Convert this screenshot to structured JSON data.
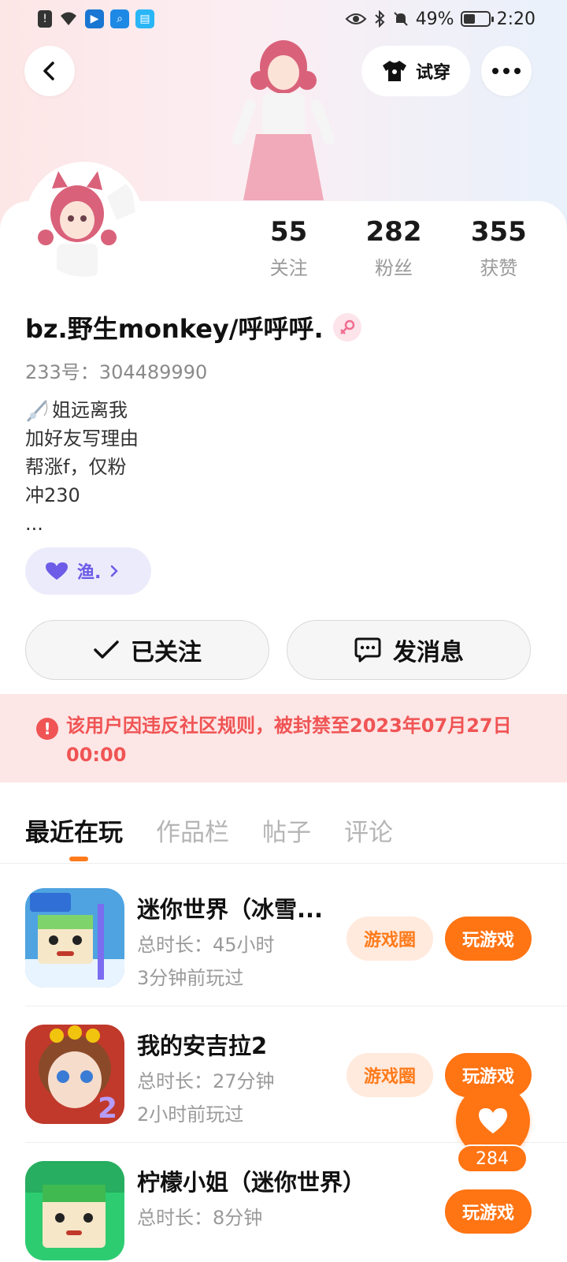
{
  "status_bar": {
    "time": "2:20",
    "battery": "49%",
    "battery_level": 0.49,
    "left_icons": [
      "alert-icon",
      "wifi-icon",
      "app-icon-blue",
      "search-app-icon",
      "reader-app-icon"
    ],
    "right_icons": [
      "eye-icon",
      "bluetooth-icon",
      "mute-icon",
      "battery-icon"
    ]
  },
  "header": {
    "back_icon": "chevron-left-icon",
    "try_on_label": "试穿",
    "try_on_icon": "tshirt-icon",
    "more_icon": "more-dots-icon"
  },
  "profile": {
    "stats": [
      {
        "value": "55",
        "label": "关注"
      },
      {
        "value": "282",
        "label": "粉丝"
      },
      {
        "value": "355",
        "label": "获赞"
      }
    ],
    "username": "bz.野生monkey/呼呼呼.",
    "gender_icon": "female-icon",
    "uid": "233号：304489990",
    "bio_lines": [
      "姐远离我",
      "加好友写理由",
      "帮涨f，仅粉",
      "冲230",
      "..."
    ],
    "bio_icon": "fishing-rod-icon",
    "tag": {
      "label": "渔.",
      "icon": "heart-icon"
    }
  },
  "actions": {
    "follow_label": "已关注",
    "message_label": "发消息"
  },
  "ban_notice": "该用户因违反社区规则，被封禁至2023年07月27日 00:00",
  "tabs": [
    "最近在玩",
    "作品栏",
    "帖子",
    "评论"
  ],
  "active_tab": 0,
  "games": [
    {
      "title": "迷你世界（冰雪...",
      "duration": "总时长：45小时",
      "last_played": "3分钟前玩过",
      "circle_label": "游戏圈",
      "play_label": "玩游戏"
    },
    {
      "title": "我的安吉拉2",
      "duration": "总时长：27分钟",
      "last_played": "2小时前玩过",
      "circle_label": "游戏圈",
      "play_label": "玩游戏"
    },
    {
      "title": "柠檬小姐（迷你世界）",
      "duration": "总时长：8分钟",
      "play_label": "玩游戏"
    }
  ],
  "like": {
    "count": "284"
  },
  "colors": {
    "accent": "#ff7413",
    "ban_red": "#f05454",
    "tag_purple": "#6c5ce7"
  }
}
